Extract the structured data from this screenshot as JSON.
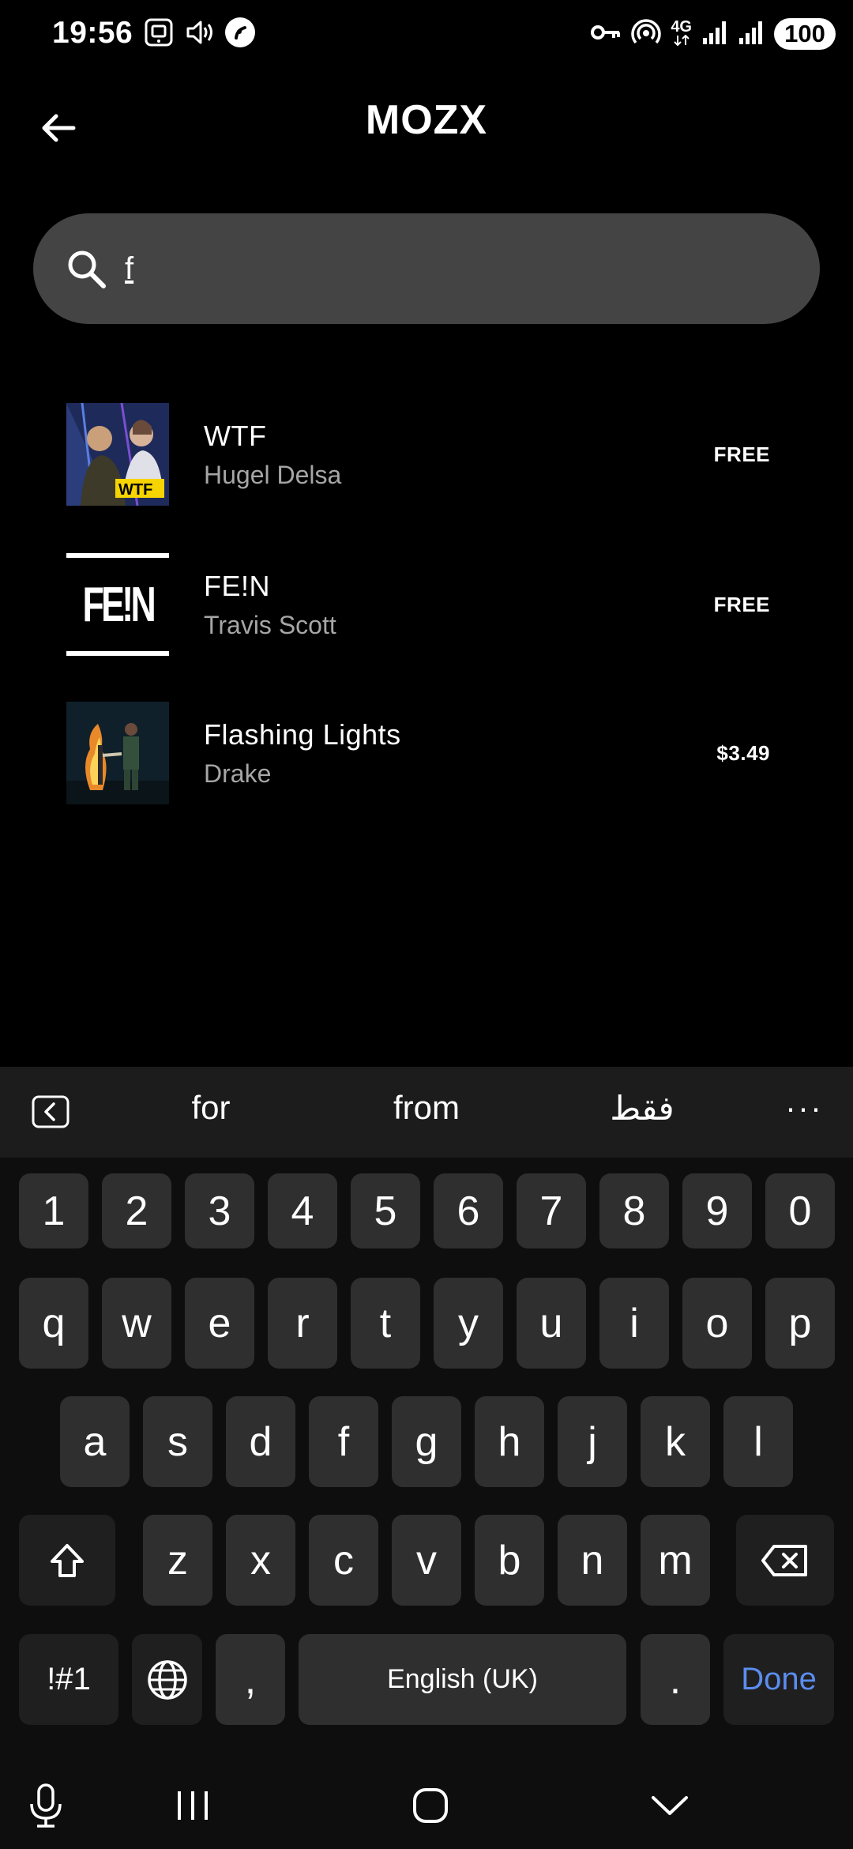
{
  "status_bar": {
    "time": "19:56",
    "battery": "100",
    "network": "4G",
    "left_icons": [
      "screenshot-icon",
      "vibrate-icon",
      "app-notification-icon"
    ],
    "right_icons": [
      "vpn-key-icon",
      "hotspot-icon",
      "network-4g-icon",
      "signal-icon",
      "signal-icon",
      "battery-icon"
    ]
  },
  "header": {
    "title": "MOZX"
  },
  "search": {
    "value": "f",
    "placeholder": ""
  },
  "results": [
    {
      "title": "WTF",
      "artist": "Hugel Delsa",
      "price": "FREE",
      "cover_icon": "album-cover-wtf"
    },
    {
      "title": "FE!N",
      "artist": "Travis Scott",
      "price": "FREE",
      "cover_icon": "album-cover-fein",
      "cover_text": "FE!N"
    },
    {
      "title": "Flashing Lights",
      "artist": "Drake",
      "price": "$3.49",
      "cover_icon": "album-cover-flashing-lights"
    }
  ],
  "keyboard": {
    "suggestions": [
      "for",
      "from",
      "فقط"
    ],
    "more_label": "···",
    "number_row": [
      "1",
      "2",
      "3",
      "4",
      "5",
      "6",
      "7",
      "8",
      "9",
      "0"
    ],
    "row1": [
      "q",
      "w",
      "e",
      "r",
      "t",
      "y",
      "u",
      "i",
      "o",
      "p"
    ],
    "row2": [
      "a",
      "s",
      "d",
      "f",
      "g",
      "h",
      "j",
      "k",
      "l"
    ],
    "row3": [
      "z",
      "x",
      "c",
      "v",
      "b",
      "n",
      "m"
    ],
    "symbols_label": "!#1",
    "comma_label": ",",
    "space_label": "English (UK)",
    "period_label": ".",
    "done_label": "Done"
  },
  "colors": {
    "background": "#000000",
    "search_bg": "#444444",
    "key_bg": "#2f2f2f",
    "accent_done": "#5b8def",
    "artist_text": "#a6a6a6"
  }
}
